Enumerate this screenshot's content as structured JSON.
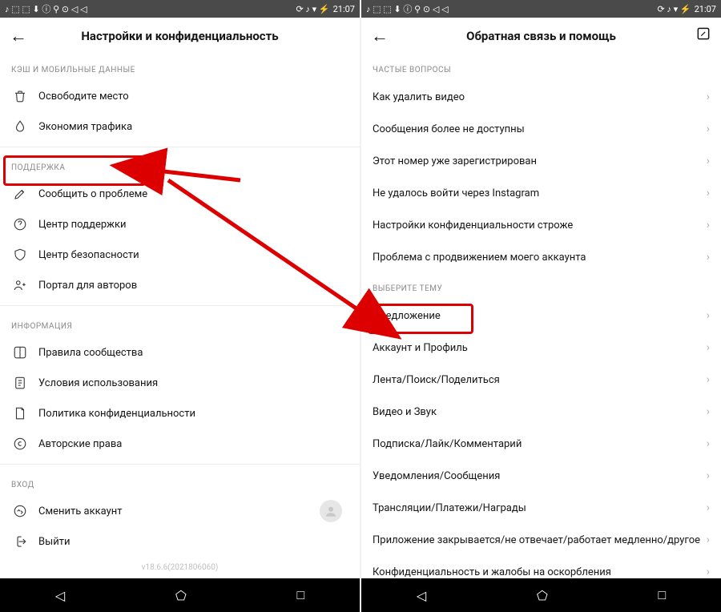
{
  "status": {
    "time": "21:07"
  },
  "left": {
    "title": "Настройки и конфиденциальность",
    "sections": {
      "cache": {
        "header": "КЭШ И МОБИЛЬНЫЕ ДАННЫЕ",
        "items": [
          "Освободите место",
          "Экономия трафика"
        ]
      },
      "support": {
        "header": "ПОДДЕРЖКА",
        "items": [
          "Сообщить о проблеме",
          "Центр поддержки",
          "Центр безопасности",
          "Портал для авторов"
        ]
      },
      "info": {
        "header": "ИНФОРМАЦИЯ",
        "items": [
          "Правила сообщества",
          "Условия использования",
          "Политика конфиденциальности",
          "Авторские права"
        ]
      },
      "login": {
        "header": "ВХОД",
        "items": [
          "Сменить аккаунт",
          "Выйти"
        ]
      }
    },
    "version": "v18.6.6(2021806060)"
  },
  "right": {
    "title": "Обратная связь и помощь",
    "faq": {
      "header": "ЧАСТЫЕ ВОПРОСЫ",
      "items": [
        "Как удалить видео",
        "Сообщения более не доступны",
        "Этот номер уже зарегистрирован",
        "Не удалось войти через Instagram",
        "Настройки конфиденциальности строже",
        "Проблема с продвижением моего аккаунта"
      ]
    },
    "topics": {
      "header": "ВЫБЕРИТЕ ТЕМУ",
      "items": [
        "Предложение",
        "Аккаунт и Профиль",
        "Лента/Поиск/Поделиться",
        "Видео и Звук",
        "Подписка/Лайк/Комментарий",
        "Уведомления/Сообщения",
        "Трансляции/Платежи/Награды",
        "Приложение закрывается/не отвечает/работает медленно/другое",
        "Конфиденциальность и жалобы на оскорбления"
      ]
    }
  }
}
